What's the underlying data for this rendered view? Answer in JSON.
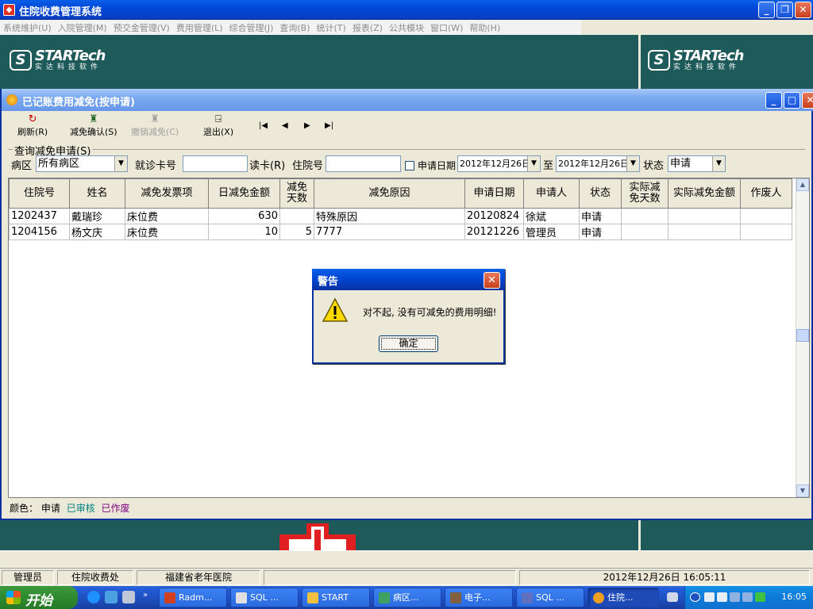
{
  "main_window": {
    "title": "住院收费管理系统",
    "controls": {
      "minimize": "_",
      "maximize": "❐",
      "close": "✕"
    }
  },
  "menu": [
    "系统维护(U)",
    "入院管理(M)",
    "预交金管理(V)",
    "费用管理(L)",
    "综合管理(J)",
    "查询(B)",
    "统计(T)",
    "报表(Z)",
    "公共模块",
    "窗口(W)",
    "帮助(H)"
  ],
  "logo": {
    "mark": "S",
    "main": "STARTech",
    "sub": "实达科技软件"
  },
  "child_window": {
    "title": "已记账费用减免(按申请)",
    "toolbar": {
      "refresh": "刷新(R)",
      "confirm": "减免确认(S)",
      "cancel": "撤销减免(C)",
      "exit": "退出(X)",
      "nav": {
        "first": "|◀",
        "prev": "◀",
        "next": "▶",
        "last": "▶|"
      }
    },
    "query": {
      "group_title": "查询减免申请(S)",
      "ward_label": "病区",
      "ward_value": "所有病区",
      "card_label": "就诊卡号",
      "card_value": "",
      "read_card": "读卡(R)",
      "inpatient_label": "住院号",
      "inpatient_value": "",
      "date_label": "申请日期",
      "date_from": "2012年12月26日",
      "to_label": "至",
      "date_to": "2012年12月26日",
      "status_label": "状态",
      "status_value": "申请"
    },
    "grid": {
      "headers": [
        "住院号",
        "姓名",
        "减免发票项",
        "日减免金额",
        "减免天数",
        "减免原因",
        "申请日期",
        "申请人",
        "状态",
        "实际减免天数",
        "实际减免金额",
        "作废人"
      ],
      "rows": [
        [
          "1202437",
          "戴瑞珍",
          "床位费",
          "630",
          "",
          "特殊原因",
          "20120824",
          "徐斌",
          "申请",
          "",
          "",
          ""
        ],
        [
          "1204156",
          "杨文庆",
          "床位费",
          "10",
          "5",
          "7777",
          "20121226",
          "管理员",
          "申请",
          "",
          "",
          ""
        ]
      ]
    },
    "color_legend": {
      "label": "颜色：",
      "applied": "申请",
      "approved": "已审核",
      "voided": "已作废",
      "colors": {
        "applied": "#000000",
        "approved": "#008080",
        "voided": "#800080"
      }
    }
  },
  "dialog": {
    "title": "警告",
    "message": "对不起, 没有可减免的费用明细!",
    "ok": "确定",
    "close": "✕"
  },
  "statusbar": {
    "user": "管理员",
    "dept": "住院收费处",
    "hospital": "福建省老年医院",
    "datetime": "2012年12月26日 16:05:11"
  },
  "taskbar": {
    "start": "开始",
    "tasks": [
      "Radm...",
      "SQL ...",
      "START",
      "病区...",
      "电子...",
      "SQL ...",
      "住院..."
    ],
    "clock": "16:05"
  }
}
